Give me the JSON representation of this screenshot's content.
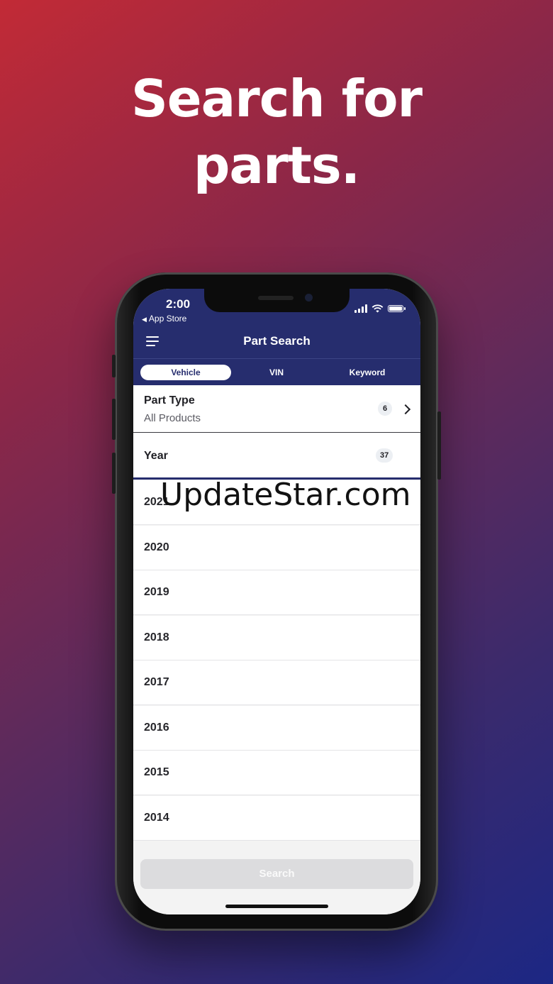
{
  "headline": {
    "line1": "Search for",
    "line2": "parts."
  },
  "status_bar": {
    "time": "2:00",
    "back_label": "App Store",
    "icons": [
      "signal-icon",
      "wifi-icon",
      "battery-icon"
    ]
  },
  "header": {
    "title": "Part Search",
    "menu_icon": "hamburger-menu-icon"
  },
  "tabs": [
    {
      "label": "Vehicle",
      "active": true
    },
    {
      "label": "VIN",
      "active": false
    },
    {
      "label": "Keyword",
      "active": false
    }
  ],
  "part_type": {
    "label": "Part Type",
    "value": "All Products",
    "count": "6"
  },
  "year": {
    "label": "Year",
    "count": "37"
  },
  "years": [
    "2021",
    "2020",
    "2019",
    "2018",
    "2017",
    "2016",
    "2015",
    "2014"
  ],
  "search_button": {
    "label": "Search"
  },
  "watermark": "UpdateStar.com",
  "colors": {
    "brand_navy": "#262d6e",
    "background_red": "#c22a36",
    "background_blue": "#1c2784"
  }
}
